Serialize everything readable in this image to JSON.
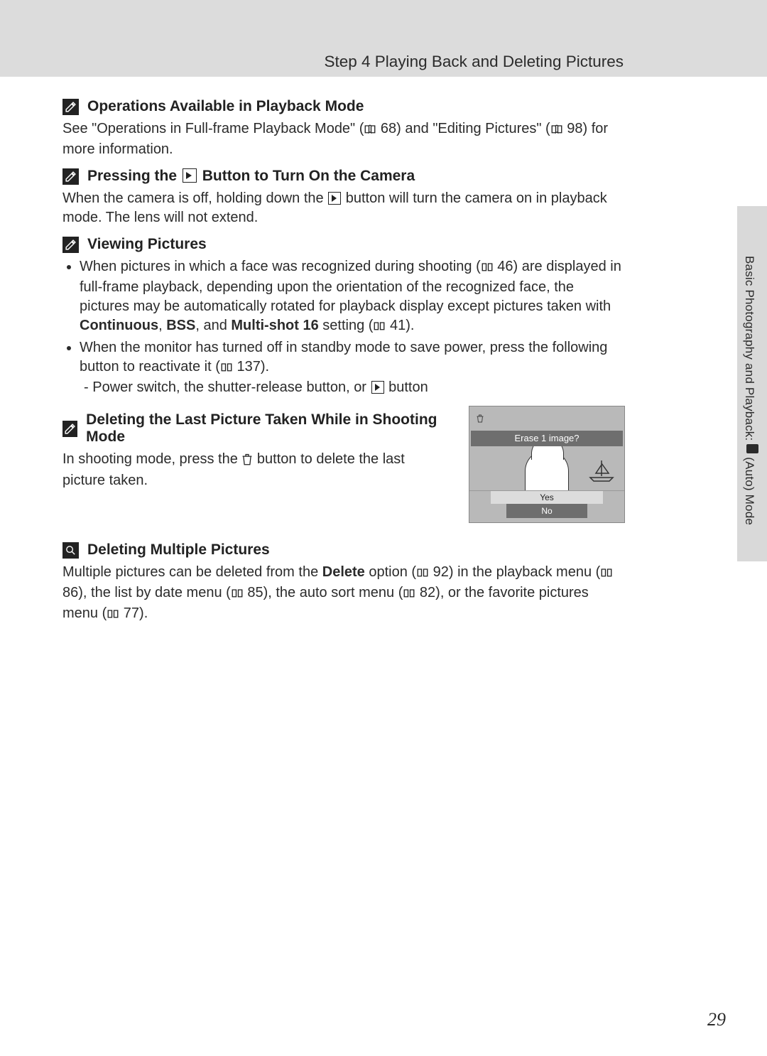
{
  "header": {
    "title": "Step 4 Playing Back and Deleting Pictures"
  },
  "sidebar": {
    "label_before": "Basic Photography and Playback: ",
    "label_after": " (Auto) Mode"
  },
  "sections": {
    "s1": {
      "title": "Operations Available in Playback Mode",
      "body_a": "See \"Operations in Full-frame Playback Mode\" (",
      "ref1": " 68) and \"Editing Pictures\" (",
      "ref2": " 98) for more information."
    },
    "s2": {
      "title_a": "Pressing the ",
      "title_b": " Button to Turn On the Camera",
      "body_a": "When the camera is off, holding down the ",
      "body_b": " button will turn the camera on in playback mode. The lens will not extend."
    },
    "s3": {
      "title": "Viewing Pictures",
      "li1_a": "When pictures in which a face was recognized during shooting (",
      "li1_b": " 46) are displayed in full-frame playback, depending upon the orientation of the recognized face, the pictures may be automatically rotated for playback display except pictures taken with ",
      "li1_c": "Continuous",
      "li1_d": ", ",
      "li1_e": "BSS",
      "li1_f": ", and ",
      "li1_g": "Multi-shot 16",
      "li1_h": " setting (",
      "li1_i": " 41).",
      "li2_a": "When the monitor has turned off in standby mode to save power, press the following button to reactivate it (",
      "li2_b": " 137).",
      "li2_c": " Power switch, the shutter-release button, or ",
      "li2_d": " button"
    },
    "s4": {
      "title": "Deleting the Last Picture Taken While in Shooting Mode",
      "body_a": "In shooting mode, press the ",
      "body_b": " button to delete the last picture taken."
    },
    "s5": {
      "title": "Deleting Multiple Pictures",
      "body_a": "Multiple pictures can be deleted from the ",
      "body_b": "Delete",
      "body_c": " option (",
      "body_d": " 92) in the playback menu (",
      "body_e": " 86), the list by date menu (",
      "body_f": " 85), the auto sort menu (",
      "body_g": " 82), or the favorite pictures menu (",
      "body_h": " 77)."
    }
  },
  "camera_screen": {
    "prompt": "Erase 1 image?",
    "yes": "Yes",
    "no": "No"
  },
  "page_number": "29"
}
